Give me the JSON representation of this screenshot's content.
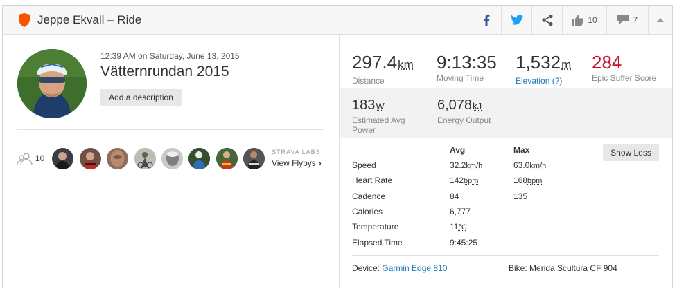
{
  "header": {
    "title": "Jeppe Ekvall – Ride",
    "kudos_count": "10",
    "comments_count": "7"
  },
  "activity": {
    "datetime": "12:39 AM on Saturday, June 13, 2015",
    "name": "Vätternrundan 2015",
    "add_description_label": "Add a description"
  },
  "athletes": {
    "count": "10",
    "labs_label": "STRAVA LABS",
    "flybys_label": "View Flybys"
  },
  "stats": {
    "distance": {
      "value": "297.4",
      "unit": "km",
      "label": "Distance"
    },
    "moving_time": {
      "value": "9:13:35",
      "label": "Moving Time"
    },
    "elevation": {
      "value": "1,532",
      "unit": "m",
      "label": "Elevation (?)"
    },
    "suffer": {
      "value": "284",
      "label": "Epic Suffer Score"
    },
    "power": {
      "value": "183",
      "unit": "W",
      "label": "Estimated Avg Power"
    },
    "energy": {
      "value": "6,078",
      "unit": "kJ",
      "label": "Energy Output"
    }
  },
  "details": {
    "avg_header": "Avg",
    "max_header": "Max",
    "show_less_label": "Show Less",
    "rows": [
      {
        "label": "Speed",
        "avg": "32.2",
        "avg_unit": "km/h",
        "max": "63.0",
        "max_unit": "km/h"
      },
      {
        "label": "Heart Rate",
        "avg": "142",
        "avg_unit": "bpm",
        "max": "168",
        "max_unit": "bpm"
      },
      {
        "label": "Cadence",
        "avg": "84",
        "avg_unit": "",
        "max": "135",
        "max_unit": ""
      },
      {
        "label": "Calories",
        "avg": "6,777",
        "avg_unit": "",
        "max": "",
        "max_unit": ""
      },
      {
        "label": "Temperature",
        "avg": "11",
        "avg_unit": "°C",
        "max": "",
        "max_unit": ""
      },
      {
        "label": "Elapsed Time",
        "avg": "9:45:25",
        "avg_unit": "",
        "max": "",
        "max_unit": ""
      }
    ],
    "device_label": "Device:",
    "device_value": "Garmin Edge 810",
    "bike_label": "Bike:",
    "bike_value": "Merida Scultura CF 904"
  },
  "colors": {
    "strava_orange": "#fc5200",
    "suffer_red": "#c8102e",
    "link_blue": "#1a7bb9",
    "facebook_blue": "#3b5998",
    "twitter_blue": "#1da1f2"
  }
}
